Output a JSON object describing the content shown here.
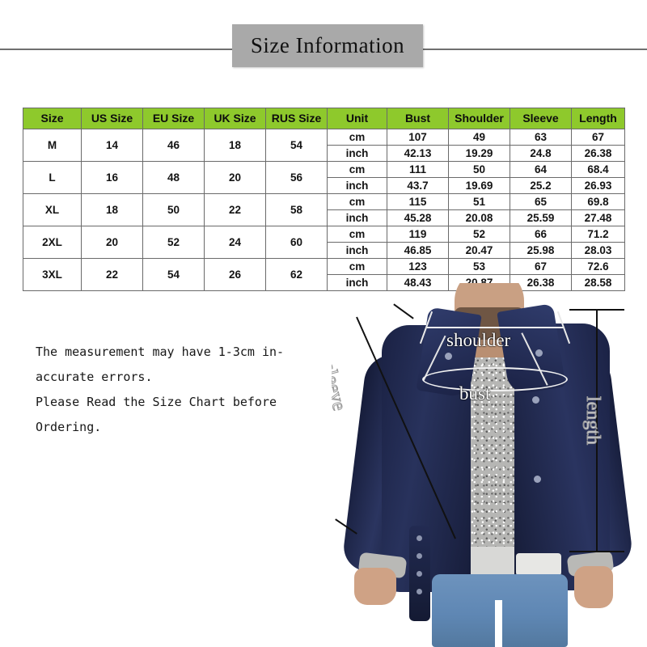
{
  "header": {
    "title": "Size Information"
  },
  "table": {
    "columns": [
      "Size",
      "US Size",
      "EU Size",
      "UK Size",
      "RUS Size",
      "Unit",
      "Bust",
      "Shoulder",
      "Sleeve",
      "Length"
    ],
    "header_bg": "#8ec92c",
    "units": [
      "cm",
      "inch"
    ],
    "rows": [
      {
        "size": "M",
        "us": "14",
        "eu": "46",
        "uk": "18",
        "rus": "54",
        "cm": {
          "unit": "cm",
          "bust": "107",
          "shoulder": "49",
          "sleeve": "63",
          "length": "67"
        },
        "inch": {
          "unit": "inch",
          "bust": "42.13",
          "shoulder": "19.29",
          "sleeve": "24.8",
          "length": "26.38"
        }
      },
      {
        "size": "L",
        "us": "16",
        "eu": "48",
        "uk": "20",
        "rus": "56",
        "cm": {
          "unit": "cm",
          "bust": "111",
          "shoulder": "50",
          "sleeve": "64",
          "length": "68.4"
        },
        "inch": {
          "unit": "inch",
          "bust": "43.7",
          "shoulder": "19.69",
          "sleeve": "25.2",
          "length": "26.93"
        }
      },
      {
        "size": "XL",
        "us": "18",
        "eu": "50",
        "uk": "22",
        "rus": "58",
        "cm": {
          "unit": "cm",
          "bust": "115",
          "shoulder": "51",
          "sleeve": "65",
          "length": "69.8"
        },
        "inch": {
          "unit": "inch",
          "bust": "45.28",
          "shoulder": "20.08",
          "sleeve": "25.59",
          "length": "27.48"
        }
      },
      {
        "size": "2XL",
        "us": "20",
        "eu": "52",
        "uk": "24",
        "rus": "60",
        "cm": {
          "unit": "cm",
          "bust": "119",
          "shoulder": "52",
          "sleeve": "66",
          "length": "71.2"
        },
        "inch": {
          "unit": "inch",
          "bust": "46.85",
          "shoulder": "20.47",
          "sleeve": "25.98",
          "length": "28.03"
        }
      },
      {
        "size": "3XL",
        "us": "22",
        "eu": "54",
        "uk": "26",
        "rus": "62",
        "cm": {
          "unit": "cm",
          "bust": "123",
          "shoulder": "53",
          "sleeve": "67",
          "length": "72.6"
        },
        "inch": {
          "unit": "inch",
          "bust": "48.43",
          "shoulder": "20.87",
          "sleeve": "26.38",
          "length": "28.58"
        }
      }
    ]
  },
  "note": {
    "lines": [
      "The measurement may have 1-3cm in-",
      "accurate errors.",
      "Please Read the Size Chart before",
      "Ordering."
    ]
  },
  "diagram": {
    "labels": {
      "shoulder": "shoulder",
      "bust": "bust",
      "sleeve": "sleeve",
      "length": "length"
    }
  }
}
